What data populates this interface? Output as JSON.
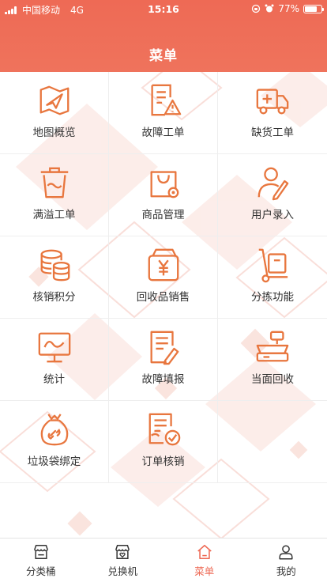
{
  "status_bar": {
    "carrier": "中国移动",
    "network": "4G",
    "time": "15:16",
    "battery": "77%",
    "battery_level": 0.77
  },
  "header": {
    "title": "菜单"
  },
  "colors": {
    "accent": "#ee6a55",
    "icon": "#e8763e"
  },
  "menu": [
    {
      "label": "地图概览",
      "icon": "map-icon"
    },
    {
      "label": "故障工单",
      "icon": "fault-order-icon"
    },
    {
      "label": "缺货工单",
      "icon": "shortage-truck-icon"
    },
    {
      "label": "满溢工单",
      "icon": "overflow-bin-icon"
    },
    {
      "label": "商品管理",
      "icon": "product-bag-icon"
    },
    {
      "label": "用户录入",
      "icon": "user-entry-icon"
    },
    {
      "label": "核销积分",
      "icon": "coins-icon"
    },
    {
      "label": "回收品销售",
      "icon": "wallet-yen-icon"
    },
    {
      "label": "分拣功能",
      "icon": "hand-truck-icon"
    },
    {
      "label": "统计",
      "icon": "monitor-chart-icon"
    },
    {
      "label": "故障填报",
      "icon": "report-form-icon"
    },
    {
      "label": "当面回收",
      "icon": "scale-icon"
    },
    {
      "label": "垃圾袋绑定",
      "icon": "link-bag-icon"
    },
    {
      "label": "订单核销",
      "icon": "order-check-icon"
    }
  ],
  "tabs": [
    {
      "label": "分类桶",
      "icon": "store-icon",
      "active": false
    },
    {
      "label": "兑换机",
      "icon": "machine-icon",
      "active": false
    },
    {
      "label": "菜单",
      "icon": "home-icon",
      "active": true
    },
    {
      "label": "我的",
      "icon": "person-icon",
      "active": false
    }
  ]
}
